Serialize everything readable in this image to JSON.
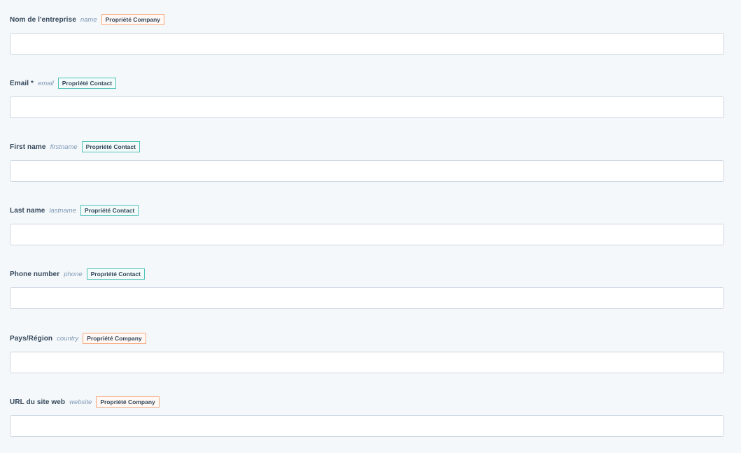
{
  "fields": [
    {
      "label": "Nom de l'entreprise",
      "internal_name": "name",
      "property": "Propriété Company",
      "value": ""
    },
    {
      "label": "Email *",
      "internal_name": "email",
      "property": "Propriété Contact",
      "value": ""
    },
    {
      "label": "First name",
      "internal_name": "firstname",
      "property": "Propriété Contact",
      "value": ""
    },
    {
      "label": "Last name",
      "internal_name": "lastname",
      "property": "Propriété Contact",
      "value": ""
    },
    {
      "label": "Phone number",
      "internal_name": "phone",
      "property": "Propriété Contact",
      "value": ""
    },
    {
      "label": "Pays/Région",
      "internal_name": "country",
      "property": "Propriété Company",
      "value": ""
    },
    {
      "label": "URL du site web",
      "internal_name": "website",
      "property": "Propriété Company",
      "value": ""
    }
  ],
  "colors": {
    "company_badge_border": "#f5a97f",
    "contact_badge_border": "#4fc2b9",
    "input_border": "#cbd6e2",
    "page_background": "#f5f8fa"
  }
}
